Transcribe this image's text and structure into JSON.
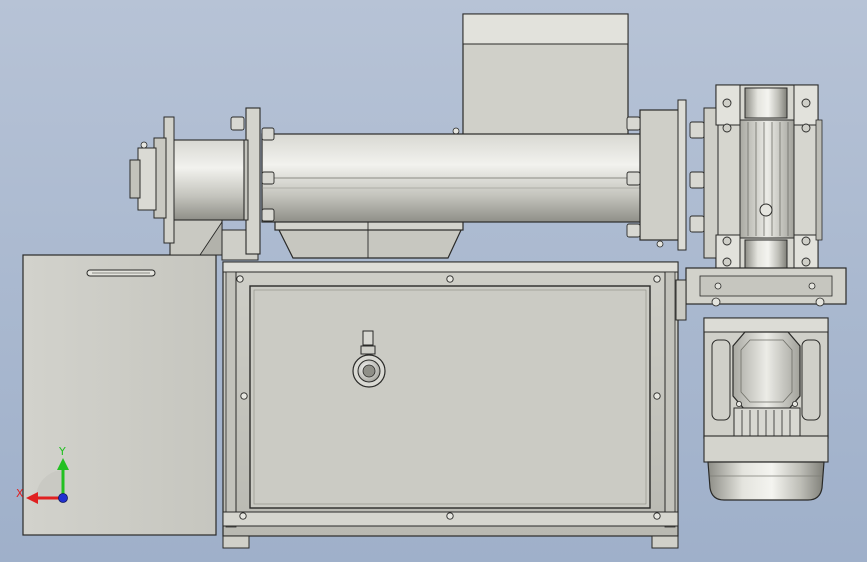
{
  "triad": {
    "x_label": "X",
    "y_label": "Y",
    "colors": {
      "x": "#e02020",
      "y": "#22c022",
      "z": "#2030d0"
    }
  },
  "colors": {
    "background_top": "#b7c3d6",
    "background_bottom": "#9fb0ca",
    "metal_light": "#e8e8e2",
    "metal_mid": "#c9c9c2",
    "metal_dark": "#9a9a92",
    "edge": "#2a2a28"
  }
}
